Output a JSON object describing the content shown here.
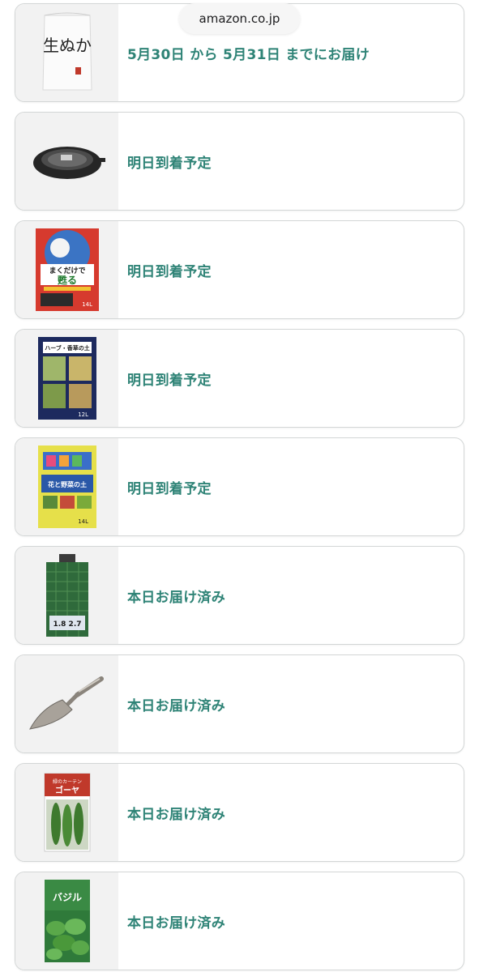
{
  "browser": {
    "url": "amazon.co.jp"
  },
  "orders": [
    {
      "status": "5月30日 から 5月31日 までにお届け",
      "icon": "rice-bran-bag"
    },
    {
      "status": "明日到着予定",
      "icon": "plant-saucer"
    },
    {
      "status": "明日到着予定",
      "icon": "soil-bag-makudake"
    },
    {
      "status": "明日到着予定",
      "icon": "herb-soil-bag"
    },
    {
      "status": "明日到着予定",
      "icon": "vegetable-soil-bag"
    },
    {
      "status": "本日お届け済み",
      "icon": "garden-net"
    },
    {
      "status": "本日お届け済み",
      "icon": "hand-trowel"
    },
    {
      "status": "本日お届け済み",
      "icon": "goya-seed-packet"
    },
    {
      "status": "本日お届け済み",
      "icon": "basil-seed-packet"
    }
  ],
  "thumb_labels": {
    "rice_bran": "生ぬか",
    "soil_brand": "まくだけで",
    "soil_revive": "甦る",
    "soil_weight": "14L",
    "herb_soil": "ハーブ・香草の土",
    "herb_weight": "12L",
    "veg_soil": "花と野菜の土",
    "veg_weight": "14L",
    "net_size": "1.8 2.7",
    "goya_title": "緑のカーテン",
    "goya_name": "ゴーヤ",
    "basil_name": "バジル"
  },
  "colors": {
    "status_text": "#2e8376",
    "card_border": "#d3d6d6",
    "thumb_bg": "#f2f2f2"
  }
}
